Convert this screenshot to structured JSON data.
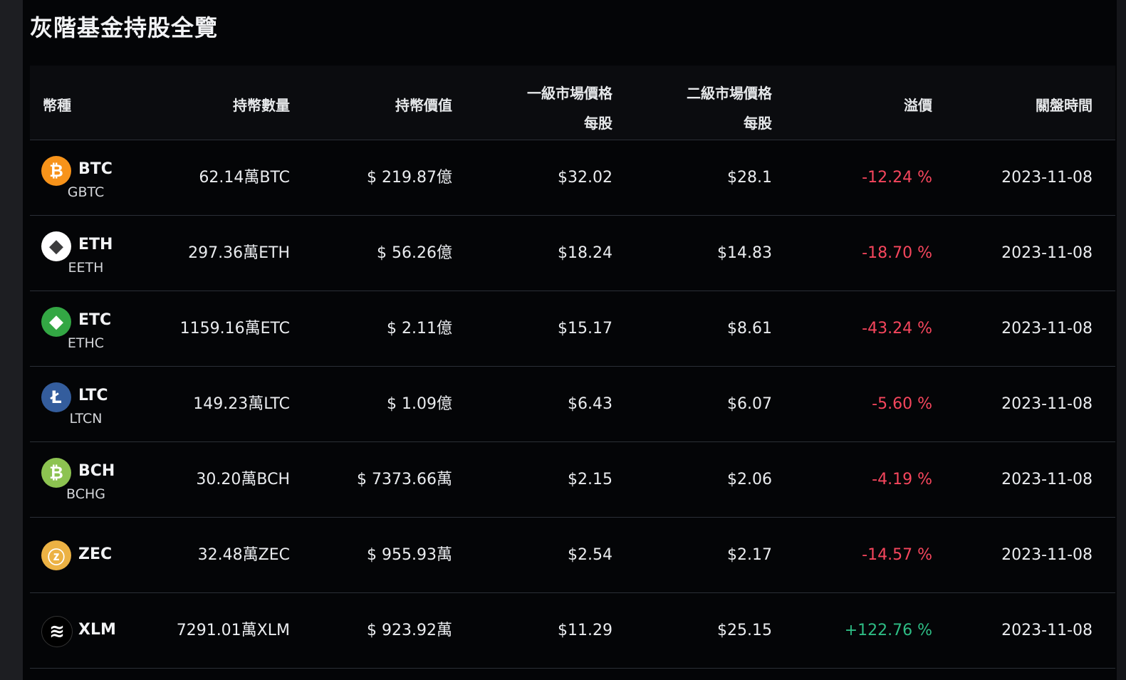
{
  "title": "灰階基金持股全覽",
  "headers": {
    "coin": "幣種",
    "holding": "持幣數量",
    "value": "持幣價值",
    "primary_l1": "一級市場價格",
    "primary_l2": "每股",
    "secondary_l1": "二級市場價格",
    "secondary_l2": "每股",
    "premium": "溢價",
    "close_time": "關盤時間"
  },
  "rows": [
    {
      "symbol": "BTC",
      "fund": "GBTC",
      "icon": "bitcoin-icon",
      "glyph": "₿",
      "color": "#f7931a",
      "holding": "62.14萬BTC",
      "value": "$ 219.87億",
      "primary": "$32.02",
      "secondary": "$28.1",
      "premium": "-12.24 %",
      "trend": "neg",
      "date": "2023-11-08"
    },
    {
      "symbol": "ETH",
      "fund": "EETH",
      "icon": "ethereum-icon",
      "glyph": "◆",
      "color": "#ffffff",
      "holding": "297.36萬ETH",
      "value": "$ 56.26億",
      "primary": "$18.24",
      "secondary": "$14.83",
      "premium": "-18.70 %",
      "trend": "neg",
      "date": "2023-11-08"
    },
    {
      "symbol": "ETC",
      "fund": "ETHC",
      "icon": "ethereum-classic-icon",
      "glyph": "◆",
      "color": "#33a744",
      "holding": "1159.16萬ETC",
      "value": "$ 2.11億",
      "primary": "$15.17",
      "secondary": "$8.61",
      "premium": "-43.24 %",
      "trend": "neg",
      "date": "2023-11-08"
    },
    {
      "symbol": "LTC",
      "fund": "LTCN",
      "icon": "litecoin-icon",
      "glyph": "Ł",
      "color": "#345d9d",
      "holding": "149.23萬LTC",
      "value": "$ 1.09億",
      "primary": "$6.43",
      "secondary": "$6.07",
      "premium": "-5.60 %",
      "trend": "neg",
      "date": "2023-11-08"
    },
    {
      "symbol": "BCH",
      "fund": "BCHG",
      "icon": "bitcoin-cash-icon",
      "glyph": "₿",
      "color": "#8dc351",
      "holding": "30.20萬BCH",
      "value": "$ 7373.66萬",
      "primary": "$2.15",
      "secondary": "$2.06",
      "premium": "-4.19 %",
      "trend": "neg",
      "date": "2023-11-08"
    },
    {
      "symbol": "ZEC",
      "fund": "",
      "icon": "zcash-icon",
      "glyph": "ⓩ",
      "color": "#ecb244",
      "holding": "32.48萬ZEC",
      "value": "$ 955.93萬",
      "primary": "$2.54",
      "secondary": "$2.17",
      "premium": "-14.57 %",
      "trend": "neg",
      "date": "2023-11-08"
    },
    {
      "symbol": "XLM",
      "fund": "",
      "icon": "stellar-icon",
      "glyph": "≋",
      "color": "#000000",
      "holding": "7291.01萬XLM",
      "value": "$ 923.92萬",
      "primary": "$11.29",
      "secondary": "$25.15",
      "premium": "+122.76 %",
      "trend": "pos",
      "date": "2023-11-08"
    }
  ]
}
